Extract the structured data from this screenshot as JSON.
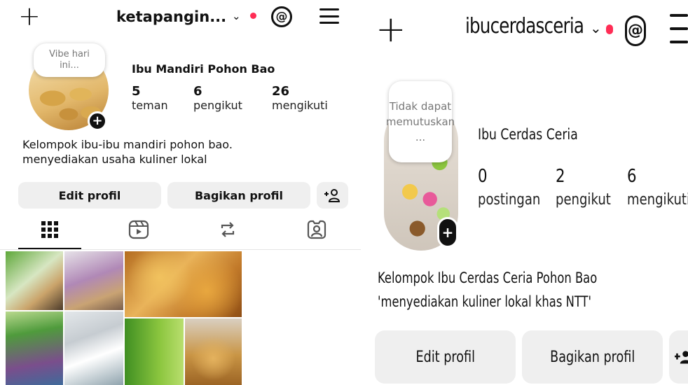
{
  "left": {
    "header": {
      "username": "ketapangin...",
      "chevron": "⌄"
    },
    "note": "Vibe hari ini...",
    "profile_name": "Ibu Mandiri Pohon Bao",
    "stats": [
      {
        "value": "5",
        "label": "teman"
      },
      {
        "value": "6",
        "label": "pengikut"
      },
      {
        "value": "26",
        "label": "mengikuti"
      }
    ],
    "bio": [
      "Kelompok ibu-ibu mandiri pohon bao.",
      "menyediakan usaha kuliner lokal"
    ],
    "buttons": {
      "edit": "Edit profil",
      "share": "Bagikan profil"
    },
    "tabs": [
      "grid-icon",
      "reels-icon",
      "reposts-icon",
      "tagged-icon"
    ]
  },
  "right": {
    "header": {
      "username": "ibucerdasceria",
      "chevron": "⌄"
    },
    "note": "Tidak dapat memutuskan ...",
    "profile_name": "Ibu Cerdas Ceria",
    "stats": [
      {
        "value": "0",
        "label": "postingan"
      },
      {
        "value": "2",
        "label": "pengikut"
      },
      {
        "value": "6",
        "label": "mengikuti"
      }
    ],
    "bio": [
      "Kelompok Ibu Cerdas Ceria Pohon Bao",
      "'menyediakan kuliner lokal khas NTT'"
    ],
    "buttons": {
      "edit": "Edit profil",
      "share": "Bagikan profil"
    }
  },
  "colors": {
    "notification_dot": "#ff2d55",
    "button_bg": "#efefef",
    "text": "#111111"
  }
}
